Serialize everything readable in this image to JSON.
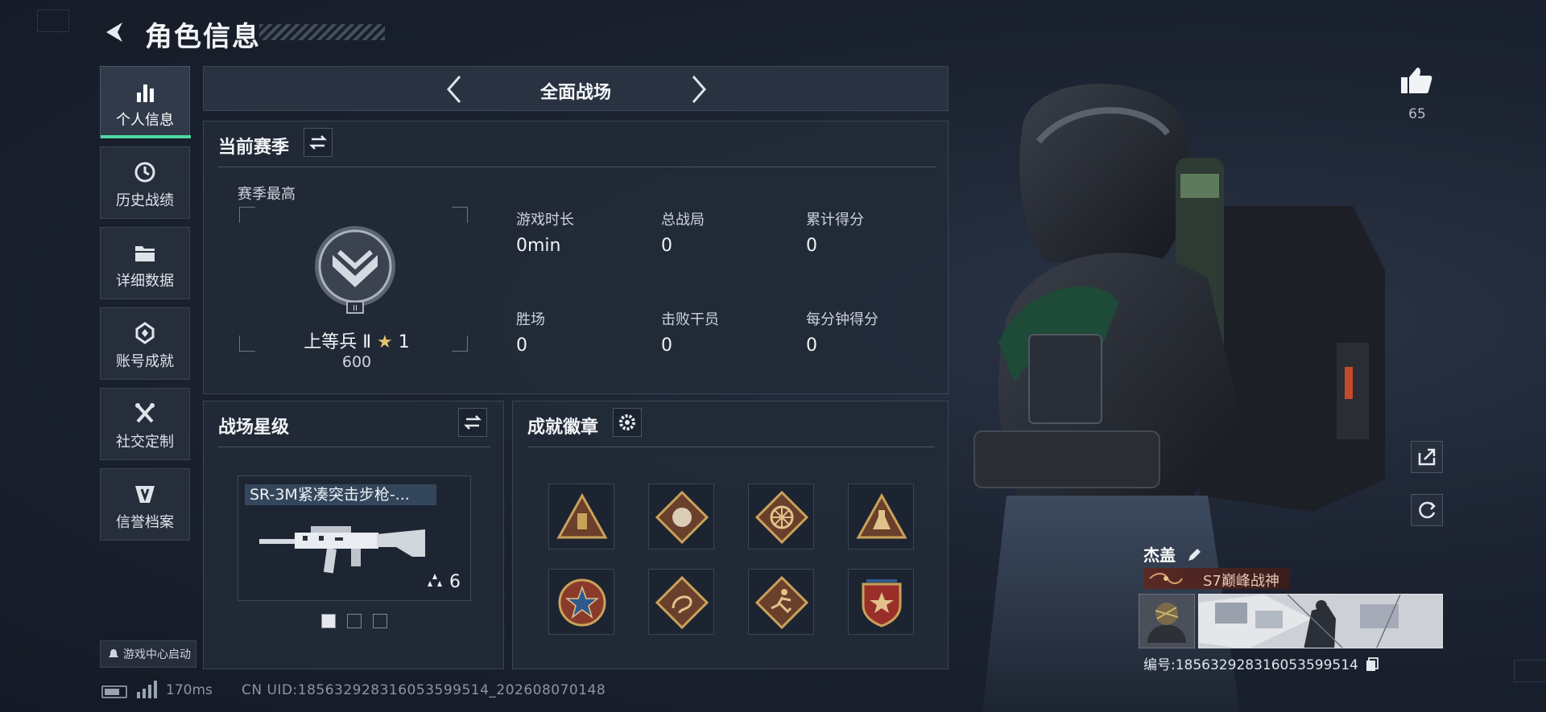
{
  "header": {
    "title": "角色信息"
  },
  "sidebar": {
    "items": [
      {
        "label": "个人信息",
        "icon": "bar-chart-icon",
        "active": true
      },
      {
        "label": "历史战绩",
        "icon": "history-icon"
      },
      {
        "label": "详细数据",
        "icon": "folder-icon"
      },
      {
        "label": "账号成就",
        "icon": "achievement-icon"
      },
      {
        "label": "社交定制",
        "icon": "tools-icon"
      },
      {
        "label": "信誉档案",
        "icon": "shield-icon"
      }
    ],
    "launch_label": "游戏中心启动"
  },
  "mode_bar": {
    "title": "全面战场"
  },
  "current_season": {
    "title": "当前赛季",
    "best_label": "赛季最高",
    "rank_name": "上等兵 Ⅱ",
    "rank_stars": "1",
    "rank_score": "600",
    "stats": [
      {
        "label": "游戏时长",
        "value": "0min"
      },
      {
        "label": "总战局",
        "value": "0"
      },
      {
        "label": "累计得分",
        "value": "0"
      },
      {
        "label": "胜场",
        "value": "0"
      },
      {
        "label": "击败干员",
        "value": "0"
      },
      {
        "label": "每分钟得分",
        "value": "0"
      }
    ]
  },
  "battlefield_stars": {
    "title": "战场星级",
    "weapon_name": "SR-3M紧凑突击步枪-...",
    "weapon_stars": "6",
    "pages": 3
  },
  "achievement_badges": {
    "title": "成就徽章",
    "badges": [
      "triangle-badge-icon",
      "wolf-badge-icon",
      "wheel-badge-icon",
      "flask-badge-icon",
      "star-wreath-badge-icon",
      "dragon-badge-icon",
      "runner-badge-icon",
      "eagle-shield-badge-icon"
    ]
  },
  "player": {
    "likes": "65",
    "name": "杰盖",
    "title_tag": "S7巅峰战神",
    "id_text": "编号:185632928316053599514"
  },
  "status_bar": {
    "ping": "170ms",
    "uid": "CN UID:185632928316053599514_202608070148"
  },
  "colors": {
    "accent_green": "#4cd8a5",
    "badge_gold": "#c9a25a",
    "badge_brown": "#6a3f2b",
    "title_tag_red": "#5a2a25"
  }
}
